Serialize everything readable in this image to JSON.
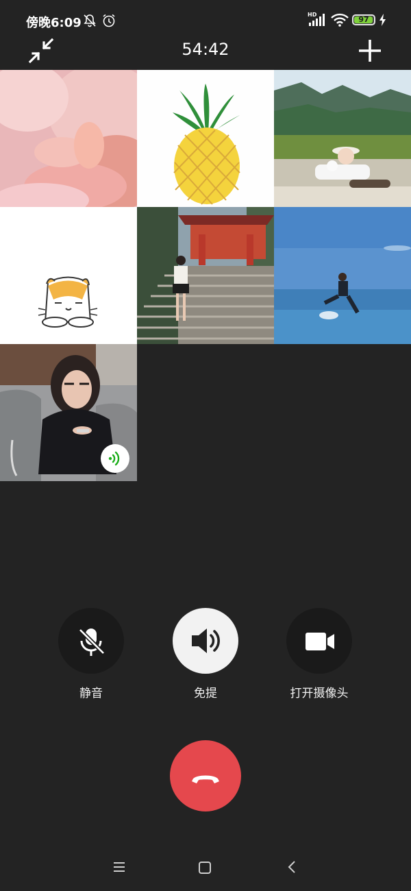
{
  "status_bar": {
    "time": "傍晚6:09",
    "network": "HD",
    "battery": "97",
    "battery_level": 0.97,
    "icons": [
      "bell-muted-icon",
      "alarm-icon",
      "signal-icon",
      "wifi-icon",
      "battery-icon",
      "charging-icon"
    ]
  },
  "call": {
    "timer": "54:42",
    "minimize_icon": "shrink-icon",
    "add_icon": "plus-icon"
  },
  "participants": [
    {
      "id": "p1",
      "avatar": "baby-hand-photo"
    },
    {
      "id": "p2",
      "avatar": "pineapple-drawing"
    },
    {
      "id": "p3",
      "avatar": "woman-lying-with-mountains"
    },
    {
      "id": "p4",
      "avatar": "cartoon-cat"
    },
    {
      "id": "p5",
      "avatar": "girl-at-temple-stairs"
    },
    {
      "id": "p6",
      "avatar": "man-jumping-sea"
    },
    {
      "id": "p7",
      "avatar": "woman-with-glasses",
      "speaking": true,
      "speaking_icon": "voice-wave-icon"
    }
  ],
  "controls": {
    "mute": {
      "label": "静音",
      "icon": "mic-off-icon",
      "active": false
    },
    "speaker": {
      "label": "免提",
      "icon": "speaker-icon",
      "active": true
    },
    "camera": {
      "label": "打开摄像头",
      "icon": "video-camera-icon",
      "active": false
    },
    "hangup_icon": "hang-up-icon"
  },
  "nav_bar": {
    "icons": [
      "menu-icon",
      "home-icon",
      "back-icon"
    ]
  },
  "colors": {
    "background": "#232323",
    "control_bg": "#1a1a1a",
    "speaker_active_bg": "#f2f2f2",
    "hangup": "#e5484d",
    "speaking": "#1aad19",
    "battery_fill": "#7ed13a"
  }
}
